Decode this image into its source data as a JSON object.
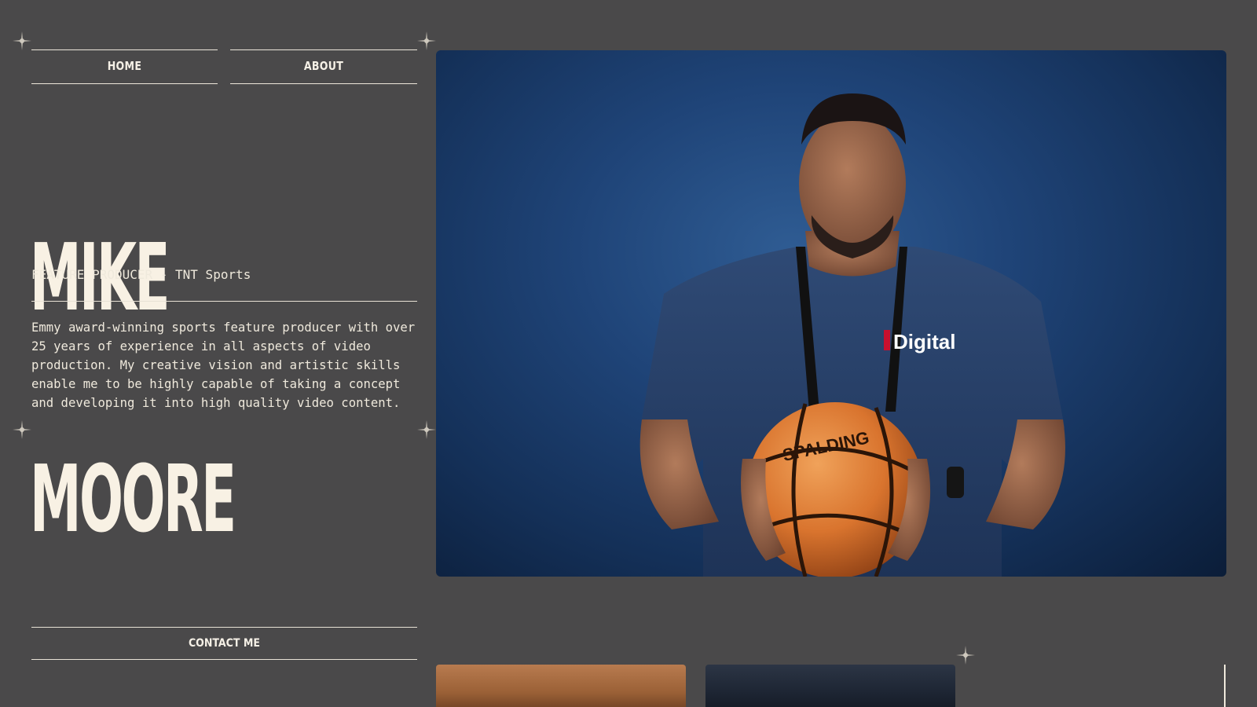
{
  "nav": {
    "home_label": "HOME",
    "about_label": "ABOUT"
  },
  "profile": {
    "first_name": "MIKE",
    "last_name": "MOORE",
    "subtitle": "FEATURE PRODUCER - TNT Sports",
    "bio": "Emmy award-winning sports feature producer with over 25 years of experience in all aspects of video production. My creative vision and artistic skills enable me to be highly capable of taking a concept and developing it into high quality video content."
  },
  "contact": {
    "label": "CONTACT ME"
  },
  "hero": {
    "shirt_text": "Digital",
    "ball_text": "SPALDING"
  },
  "colors": {
    "background": "#4a494a",
    "text": "#f3ede0",
    "hero_blue": "#1f4478"
  }
}
